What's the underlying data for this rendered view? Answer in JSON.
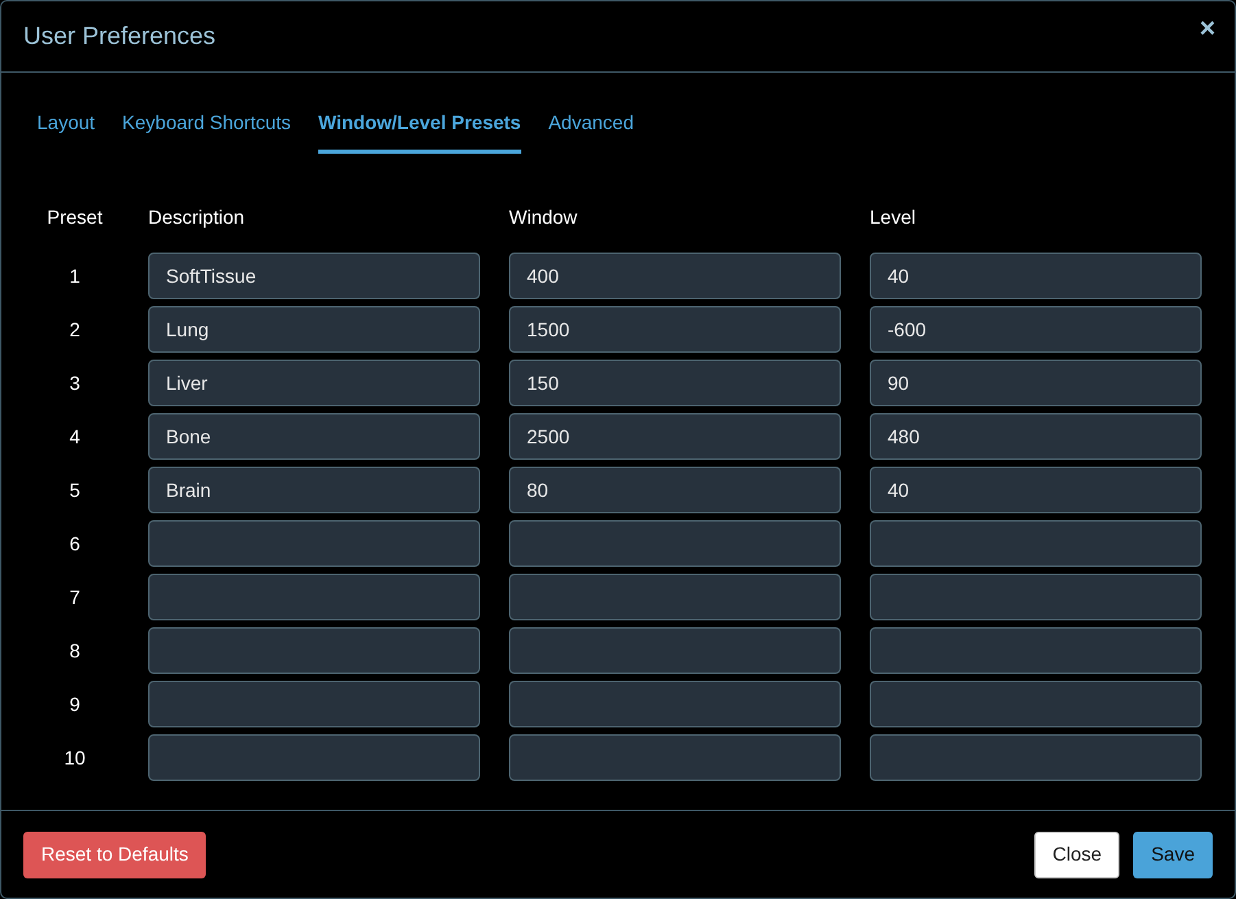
{
  "dialog": {
    "title": "User Preferences",
    "close_glyph": "×"
  },
  "tabs": [
    {
      "label": "Layout",
      "selected": false
    },
    {
      "label": "Keyboard Shortcuts",
      "selected": false
    },
    {
      "label": "Window/Level Presets",
      "selected": true
    },
    {
      "label": "Advanced",
      "selected": false
    }
  ],
  "table": {
    "columns": [
      "Preset",
      "Description",
      "Window",
      "Level"
    ],
    "rows": [
      {
        "preset": "1",
        "description": "SoftTissue",
        "window": "400",
        "level": "40"
      },
      {
        "preset": "2",
        "description": "Lung",
        "window": "1500",
        "level": "-600"
      },
      {
        "preset": "3",
        "description": "Liver",
        "window": "150",
        "level": "90"
      },
      {
        "preset": "4",
        "description": "Bone",
        "window": "2500",
        "level": "480"
      },
      {
        "preset": "5",
        "description": "Brain",
        "window": "80",
        "level": "40"
      },
      {
        "preset": "6"
      },
      {
        "preset": "7"
      },
      {
        "preset": "8"
      },
      {
        "preset": "9"
      },
      {
        "preset": "10"
      }
    ]
  },
  "footer": {
    "buttons": [
      {
        "label": "Reset to Defaults",
        "kind": "danger"
      },
      {
        "label": "Close",
        "kind": "light"
      },
      {
        "label": "Save",
        "kind": "primary"
      }
    ]
  }
}
